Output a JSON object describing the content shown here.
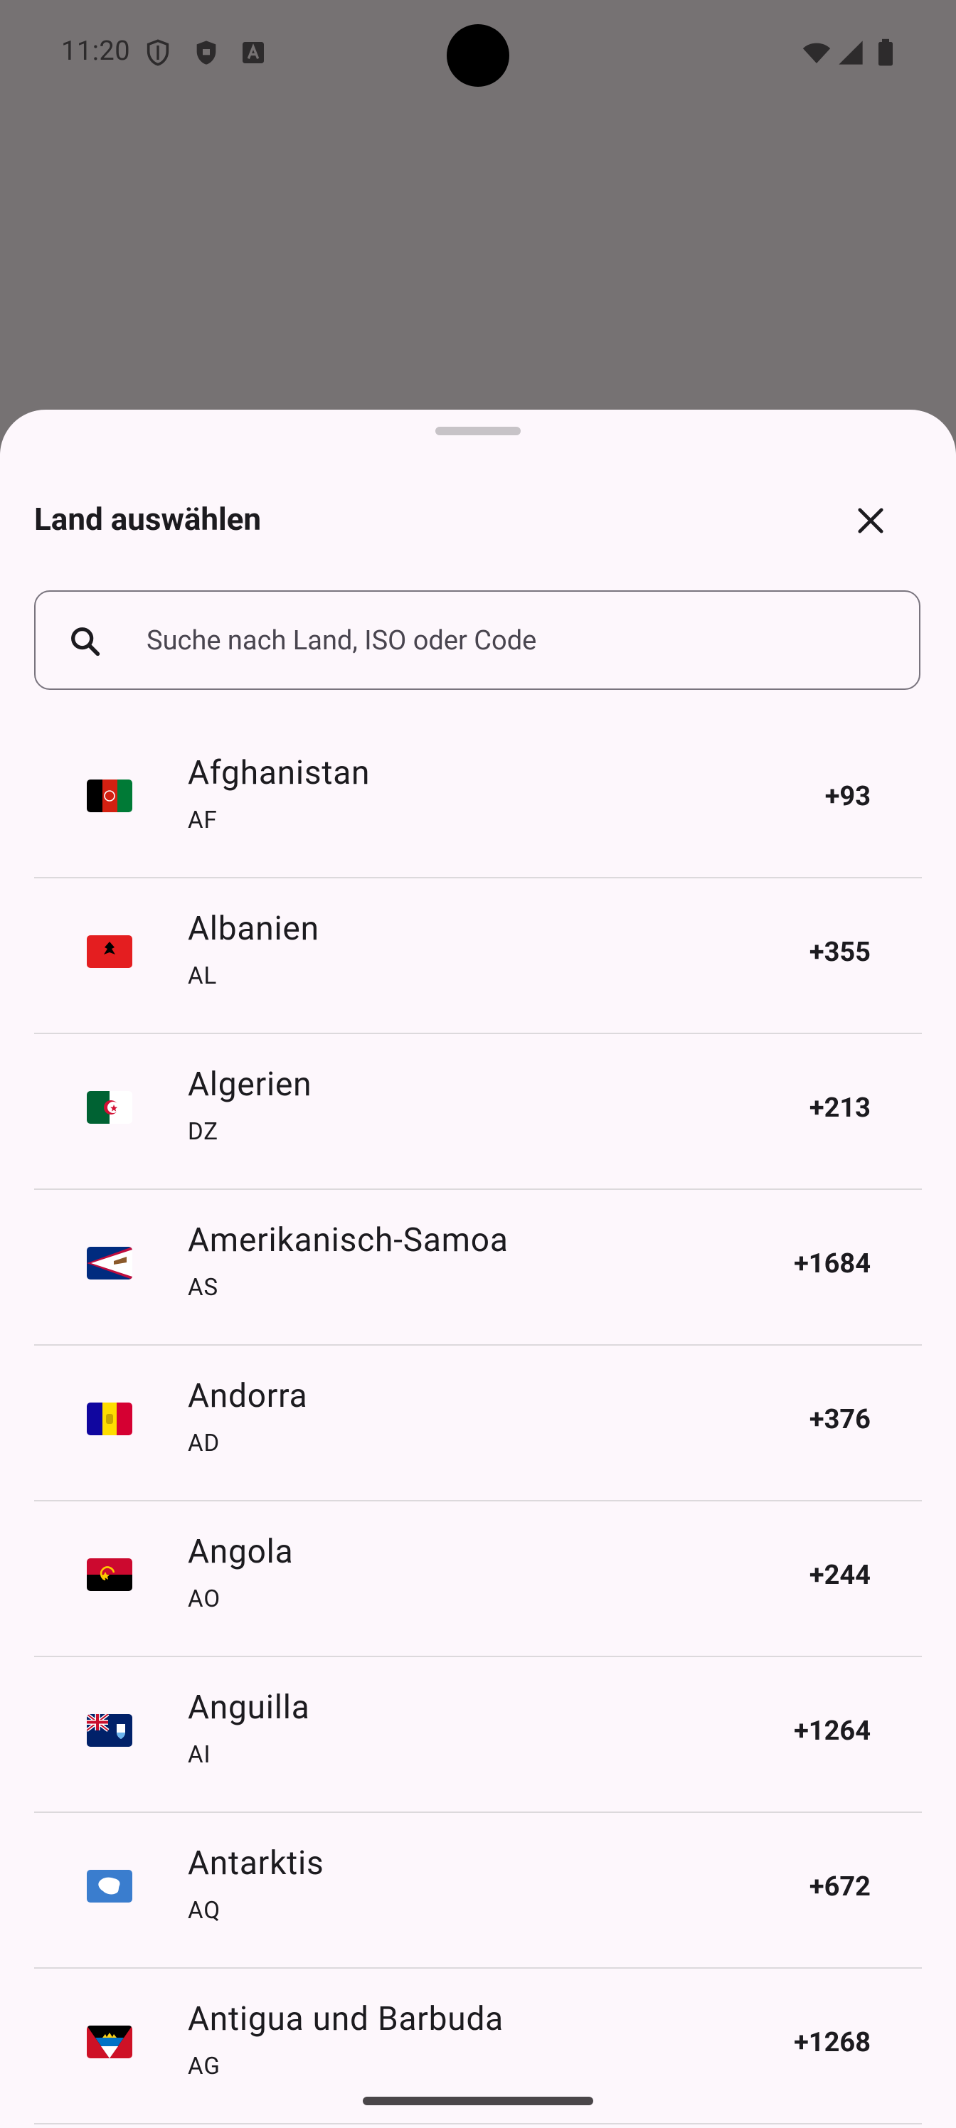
{
  "status_bar": {
    "time": "11:20",
    "left_icons": [
      "shield-outline-icon",
      "shield-filled-icon",
      "keyboard-a-icon"
    ],
    "right_icons": [
      "wifi-icon",
      "signal-icon",
      "battery-icon"
    ]
  },
  "sheet": {
    "title": "Land auswählen",
    "close_icon": "close-icon",
    "search": {
      "icon": "search-icon",
      "placeholder": "Suche nach Land, ISO oder Code",
      "value": ""
    },
    "countries": [
      {
        "name": "Afghanistan",
        "iso": "AF",
        "code": "+93",
        "flag": "af"
      },
      {
        "name": "Albanien",
        "iso": "AL",
        "code": "+355",
        "flag": "al"
      },
      {
        "name": "Algerien",
        "iso": "DZ",
        "code": "+213",
        "flag": "dz"
      },
      {
        "name": "Amerikanisch-Samoa",
        "iso": "AS",
        "code": "+1684",
        "flag": "as"
      },
      {
        "name": "Andorra",
        "iso": "AD",
        "code": "+376",
        "flag": "ad"
      },
      {
        "name": "Angola",
        "iso": "AO",
        "code": "+244",
        "flag": "ao"
      },
      {
        "name": "Anguilla",
        "iso": "AI",
        "code": "+1264",
        "flag": "ai"
      },
      {
        "name": "Antarktis",
        "iso": "AQ",
        "code": "+672",
        "flag": "aq"
      },
      {
        "name": "Antigua und Barbuda",
        "iso": "AG",
        "code": "+1268",
        "flag": "ag"
      }
    ]
  }
}
